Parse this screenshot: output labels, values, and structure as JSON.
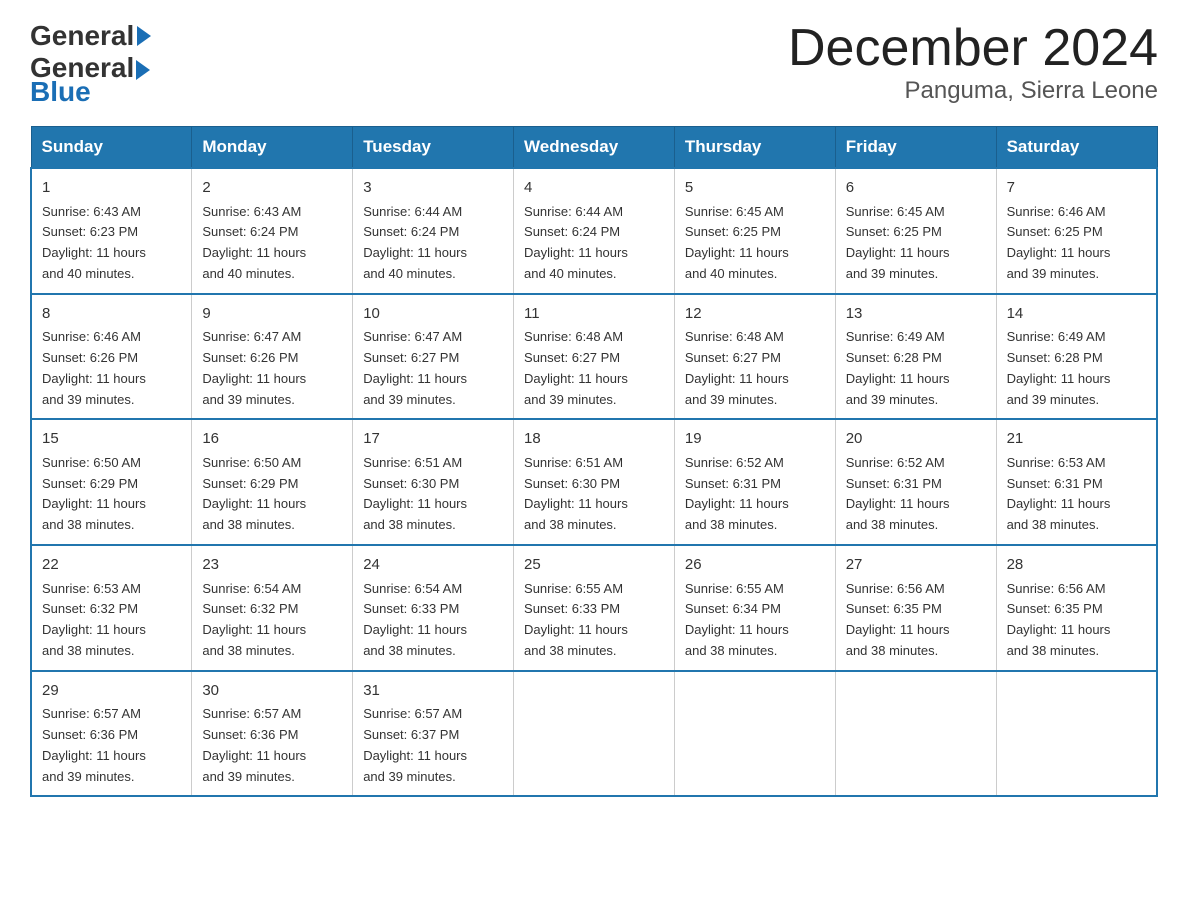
{
  "logo": {
    "general": "General",
    "blue": "Blue"
  },
  "title": "December 2024",
  "location": "Panguma, Sierra Leone",
  "days_of_week": [
    "Sunday",
    "Monday",
    "Tuesday",
    "Wednesday",
    "Thursday",
    "Friday",
    "Saturday"
  ],
  "weeks": [
    [
      {
        "day": "1",
        "sunrise": "6:43 AM",
        "sunset": "6:23 PM",
        "daylight": "11 hours and 40 minutes."
      },
      {
        "day": "2",
        "sunrise": "6:43 AM",
        "sunset": "6:24 PM",
        "daylight": "11 hours and 40 minutes."
      },
      {
        "day": "3",
        "sunrise": "6:44 AM",
        "sunset": "6:24 PM",
        "daylight": "11 hours and 40 minutes."
      },
      {
        "day": "4",
        "sunrise": "6:44 AM",
        "sunset": "6:24 PM",
        "daylight": "11 hours and 40 minutes."
      },
      {
        "day": "5",
        "sunrise": "6:45 AM",
        "sunset": "6:25 PM",
        "daylight": "11 hours and 40 minutes."
      },
      {
        "day": "6",
        "sunrise": "6:45 AM",
        "sunset": "6:25 PM",
        "daylight": "11 hours and 39 minutes."
      },
      {
        "day": "7",
        "sunrise": "6:46 AM",
        "sunset": "6:25 PM",
        "daylight": "11 hours and 39 minutes."
      }
    ],
    [
      {
        "day": "8",
        "sunrise": "6:46 AM",
        "sunset": "6:26 PM",
        "daylight": "11 hours and 39 minutes."
      },
      {
        "day": "9",
        "sunrise": "6:47 AM",
        "sunset": "6:26 PM",
        "daylight": "11 hours and 39 minutes."
      },
      {
        "day": "10",
        "sunrise": "6:47 AM",
        "sunset": "6:27 PM",
        "daylight": "11 hours and 39 minutes."
      },
      {
        "day": "11",
        "sunrise": "6:48 AM",
        "sunset": "6:27 PM",
        "daylight": "11 hours and 39 minutes."
      },
      {
        "day": "12",
        "sunrise": "6:48 AM",
        "sunset": "6:27 PM",
        "daylight": "11 hours and 39 minutes."
      },
      {
        "day": "13",
        "sunrise": "6:49 AM",
        "sunset": "6:28 PM",
        "daylight": "11 hours and 39 minutes."
      },
      {
        "day": "14",
        "sunrise": "6:49 AM",
        "sunset": "6:28 PM",
        "daylight": "11 hours and 39 minutes."
      }
    ],
    [
      {
        "day": "15",
        "sunrise": "6:50 AM",
        "sunset": "6:29 PM",
        "daylight": "11 hours and 38 minutes."
      },
      {
        "day": "16",
        "sunrise": "6:50 AM",
        "sunset": "6:29 PM",
        "daylight": "11 hours and 38 minutes."
      },
      {
        "day": "17",
        "sunrise": "6:51 AM",
        "sunset": "6:30 PM",
        "daylight": "11 hours and 38 minutes."
      },
      {
        "day": "18",
        "sunrise": "6:51 AM",
        "sunset": "6:30 PM",
        "daylight": "11 hours and 38 minutes."
      },
      {
        "day": "19",
        "sunrise": "6:52 AM",
        "sunset": "6:31 PM",
        "daylight": "11 hours and 38 minutes."
      },
      {
        "day": "20",
        "sunrise": "6:52 AM",
        "sunset": "6:31 PM",
        "daylight": "11 hours and 38 minutes."
      },
      {
        "day": "21",
        "sunrise": "6:53 AM",
        "sunset": "6:31 PM",
        "daylight": "11 hours and 38 minutes."
      }
    ],
    [
      {
        "day": "22",
        "sunrise": "6:53 AM",
        "sunset": "6:32 PM",
        "daylight": "11 hours and 38 minutes."
      },
      {
        "day": "23",
        "sunrise": "6:54 AM",
        "sunset": "6:32 PM",
        "daylight": "11 hours and 38 minutes."
      },
      {
        "day": "24",
        "sunrise": "6:54 AM",
        "sunset": "6:33 PM",
        "daylight": "11 hours and 38 minutes."
      },
      {
        "day": "25",
        "sunrise": "6:55 AM",
        "sunset": "6:33 PM",
        "daylight": "11 hours and 38 minutes."
      },
      {
        "day": "26",
        "sunrise": "6:55 AM",
        "sunset": "6:34 PM",
        "daylight": "11 hours and 38 minutes."
      },
      {
        "day": "27",
        "sunrise": "6:56 AM",
        "sunset": "6:35 PM",
        "daylight": "11 hours and 38 minutes."
      },
      {
        "day": "28",
        "sunrise": "6:56 AM",
        "sunset": "6:35 PM",
        "daylight": "11 hours and 38 minutes."
      }
    ],
    [
      {
        "day": "29",
        "sunrise": "6:57 AM",
        "sunset": "6:36 PM",
        "daylight": "11 hours and 39 minutes."
      },
      {
        "day": "30",
        "sunrise": "6:57 AM",
        "sunset": "6:36 PM",
        "daylight": "11 hours and 39 minutes."
      },
      {
        "day": "31",
        "sunrise": "6:57 AM",
        "sunset": "6:37 PM",
        "daylight": "11 hours and 39 minutes."
      },
      null,
      null,
      null,
      null
    ]
  ],
  "labels": {
    "sunrise": "Sunrise:",
    "sunset": "Sunset:",
    "daylight": "Daylight:"
  }
}
